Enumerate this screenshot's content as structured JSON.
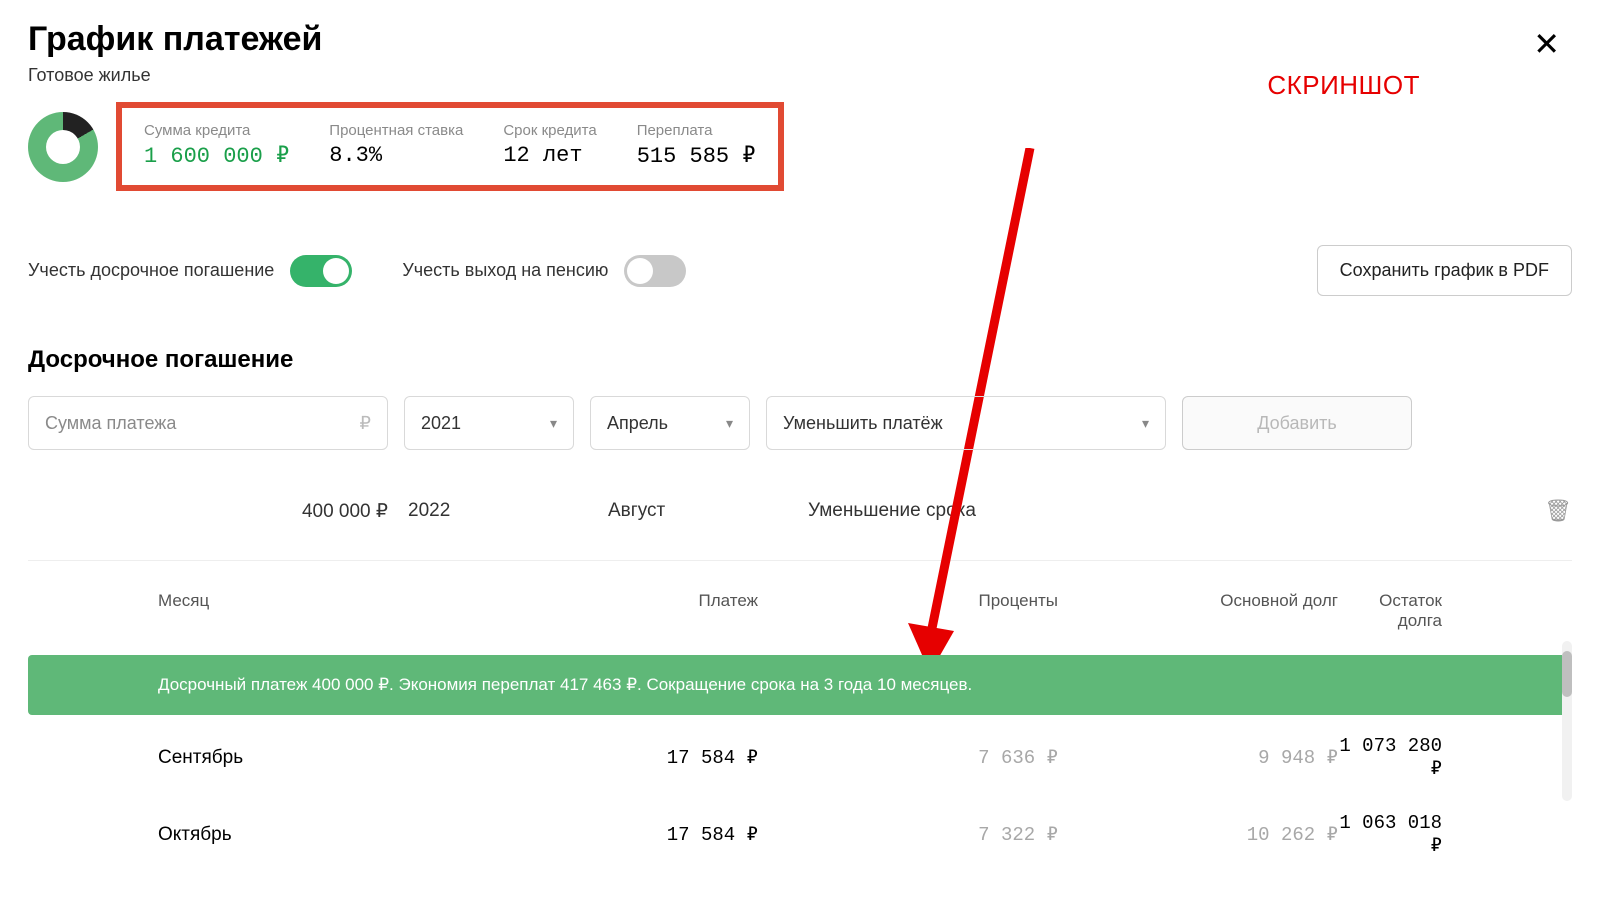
{
  "title": "График платежей",
  "subtitle": "Готовое жилье",
  "annotation": "СКРИНШОТ",
  "summary": {
    "amount_label": "Сумма кредита",
    "amount_value": "1 600 000 ₽",
    "rate_label": "Процентная ставка",
    "rate_value": "8.3%",
    "term_label": "Срок кредита",
    "term_value": "12 лет",
    "overpay_label": "Переплата",
    "overpay_value": "515 585 ₽"
  },
  "toggles": {
    "early_label": "Учесть досрочное погашение",
    "retire_label": "Учесть выход на пенсию"
  },
  "save_pdf": "Сохранить график в PDF",
  "early_section_title": "Досрочное погашение",
  "form": {
    "amount_placeholder": "Сумма платежа",
    "ruble": "₽",
    "year": "2021",
    "month": "Апрель",
    "action": "Уменьшить платёж",
    "add_btn": "Добавить"
  },
  "saved": {
    "amount": "400 000 ₽",
    "year": "2022",
    "month": "Август",
    "action": "Уменьшение срока"
  },
  "table": {
    "headers": {
      "month": "Месяц",
      "payment": "Платеж",
      "interest": "Проценты",
      "principal": "Основной долг",
      "balance": "Остаток долга"
    },
    "banner": "Досрочный платеж 400 000 ₽. Экономия переплат 417 463 ₽. Сокращение срока на 3 года 10 месяцев.",
    "rows": [
      {
        "month": "Сентябрь",
        "payment": "17 584 ₽",
        "interest": "7 636 ₽",
        "principal": "9 948 ₽",
        "balance": "1 073 280 ₽"
      },
      {
        "month": "Октябрь",
        "payment": "17 584 ₽",
        "interest": "7 322 ₽",
        "principal": "10 262 ₽",
        "balance": "1 063 018 ₽"
      }
    ]
  }
}
